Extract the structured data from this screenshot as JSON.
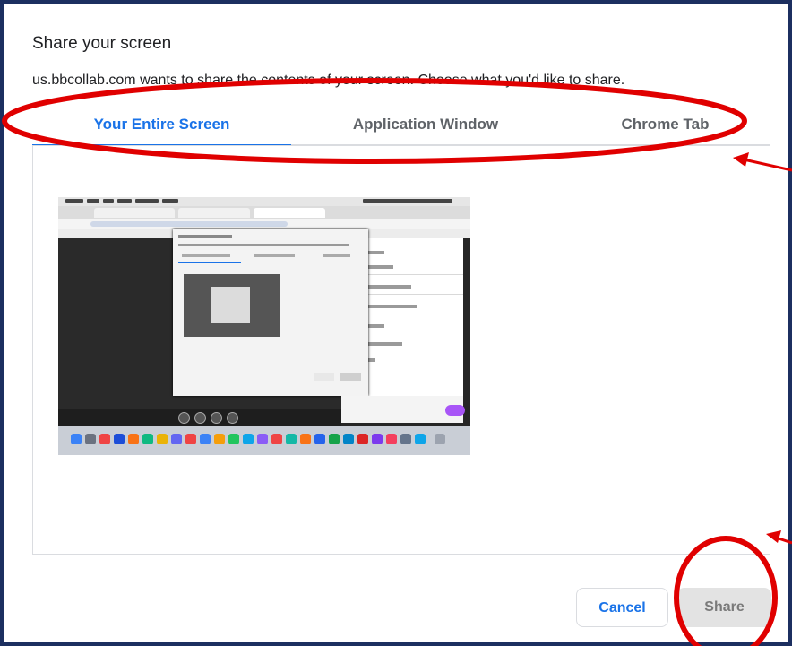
{
  "dialog": {
    "title": "Share your screen",
    "subtitle": "us.bbcollab.com wants to share the contents of your screen. Choose what you'd like to share."
  },
  "tabs": [
    {
      "label": "Your Entire Screen",
      "active": true
    },
    {
      "label": "Application Window",
      "active": false
    },
    {
      "label": "Chrome Tab",
      "active": false
    }
  ],
  "buttons": {
    "cancel_label": "Cancel",
    "share_label": "Share"
  },
  "colors": {
    "accent": "#1a73e8",
    "frame": "#1c2f60",
    "annotation": "#e00000",
    "share_disabled_bg": "#e3e3e3"
  },
  "preview": {
    "icon": "screen-thumbnail"
  }
}
